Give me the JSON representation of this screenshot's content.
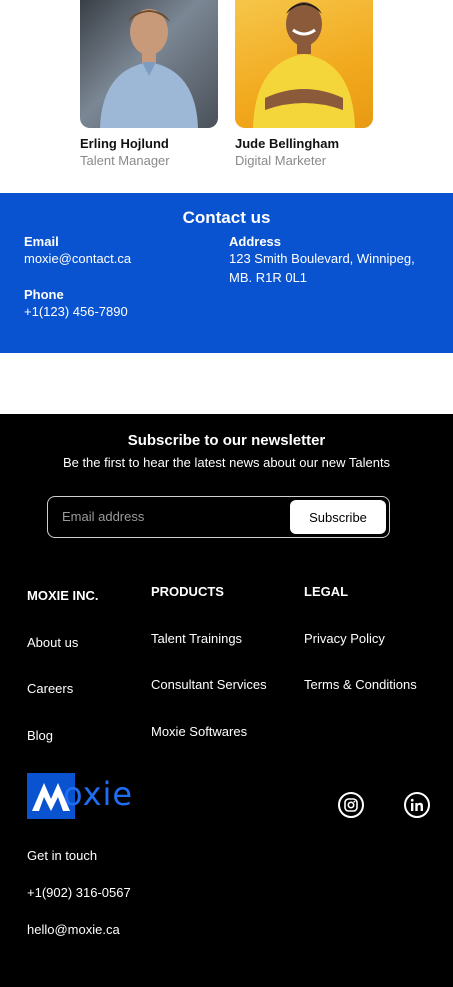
{
  "team": [
    {
      "name": "Erling Hojlund",
      "role": "Talent Manager"
    },
    {
      "name": "Jude Bellingham",
      "role": "Digital Marketer"
    }
  ],
  "contact": {
    "title": "Contact us",
    "email_label": "Email",
    "email_value": "moxie@contact.ca",
    "phone_label": "Phone",
    "phone_value": "+1(123) 456-7890",
    "address_label": "Address",
    "address_line1": "123 Smith Boulevard, Winnipeg,",
    "address_line2": "MB. R1R 0L1",
    "bg_color": "#0a53d0"
  },
  "newsletter": {
    "title": "Subscribe to our newsletter",
    "subtitle": "Be the first to hear the latest news about our new Talents",
    "email_placeholder": "Email address",
    "subscribe_label": "Subscribe"
  },
  "footer": {
    "columns": [
      {
        "heading": "MOXIE INC.",
        "links": [
          "About us",
          "Careers",
          "Blog"
        ]
      },
      {
        "heading": "PRODUCTS",
        "links": [
          "Talent Trainings",
          "Consultant Services",
          "Moxie Softwares"
        ]
      },
      {
        "heading": "LEGAL",
        "links": [
          "Privacy Policy",
          "Terms & Conditions"
        ]
      }
    ],
    "logo_text": "oxie",
    "logo_mark": "M",
    "get_in_touch": "Get in  touch",
    "phone": "+1(902) 316-0567",
    "email": "hello@moxie.ca",
    "social_icons": [
      "instagram-icon",
      "linkedin-icon"
    ]
  }
}
